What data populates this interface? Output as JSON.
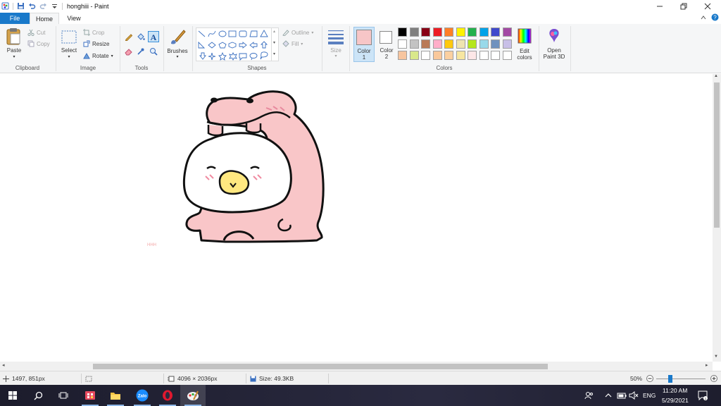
{
  "window": {
    "title": "honghiii - Paint"
  },
  "tabs": {
    "file": "File",
    "home": "Home",
    "view": "View"
  },
  "ribbon": {
    "clipboard": {
      "label": "Clipboard",
      "paste": "Paste",
      "cut": "Cut",
      "copy": "Copy"
    },
    "image": {
      "label": "Image",
      "select": "Select",
      "crop": "Crop",
      "resize": "Resize",
      "rotate": "Rotate"
    },
    "tools": {
      "label": "Tools"
    },
    "brushes": "Brushes",
    "shapes": {
      "label": "Shapes",
      "outline": "Outline",
      "fill": "Fill"
    },
    "size": "Size",
    "colors": {
      "label": "Colors",
      "color1_label": "Color",
      "color1_num": "1",
      "color2_label": "Color",
      "color2_num": "2",
      "color1_value": "#f7c6c7",
      "color2_value": "#ffffff",
      "edit_colors_1": "Edit",
      "edit_colors_2": "colors",
      "open_3d_1": "Open",
      "open_3d_2": "Paint 3D",
      "palette_row1": [
        "#000000",
        "#7f7f7f",
        "#880015",
        "#ed1c24",
        "#ff7f27",
        "#fff200",
        "#22b14c",
        "#00a2e8",
        "#3f48cc",
        "#a349a4"
      ],
      "palette_row2": [
        "#ffffff",
        "#c3c3c3",
        "#b97a57",
        "#ffaec9",
        "#ffc90e",
        "#efe4b0",
        "#b5e61d",
        "#99d9ea",
        "#7092be",
        "#c8bfe7"
      ],
      "palette_row3": [
        "#f7c59f",
        "#d9e88a",
        "#ffffff",
        "#f9c89b",
        "#fbd0a0",
        "#f7e6a0",
        "#fde7e7",
        "#ffffff",
        "#ffffff",
        "#ffffff"
      ]
    }
  },
  "canvas": {
    "tiny_text": "HHH"
  },
  "status": {
    "cursor_pos": "1497, 851px",
    "image_dims": "4096 × 2036px",
    "file_size": "Size: 49.3KB",
    "zoom": "50%"
  },
  "taskbar": {
    "time": "11:20 AM",
    "date": "5/29/2021",
    "lang": "ENG"
  }
}
